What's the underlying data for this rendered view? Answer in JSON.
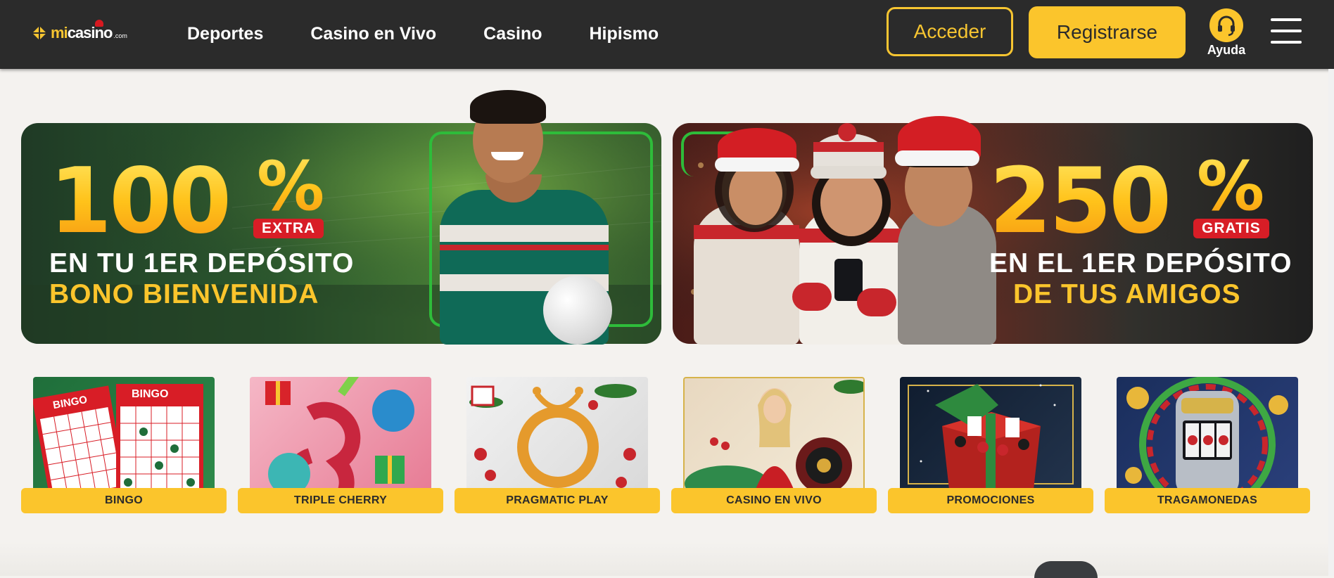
{
  "header": {
    "logo": {
      "text_mi": "mi",
      "text_casino": "casino",
      "text_dom": ".com",
      "icon": "micasino-logo-icon"
    },
    "nav": [
      {
        "label": "Deportes"
      },
      {
        "label": "Casino en Vivo"
      },
      {
        "label": "Casino"
      },
      {
        "label": "Hipismo"
      }
    ],
    "login_label": "Acceder",
    "register_label": "Registrarse",
    "help_label": "Ayuda",
    "help_icon": "headset-icon",
    "menu_icon": "hamburger-menu-icon"
  },
  "banners": {
    "left": {
      "number": "100",
      "percent": "%",
      "tag": "EXTRA",
      "line1": "EN TU 1ER DEPÓSITO",
      "line2": "BONO BIENVENIDA"
    },
    "right": {
      "number": "250",
      "percent": "%",
      "tag": "GRATIS",
      "line1": "EN EL 1ER DEPÓSITO",
      "line2": "DE TUS AMIGOS"
    }
  },
  "categories": [
    {
      "label": "BINGO"
    },
    {
      "label": "TRIPLE CHERRY"
    },
    {
      "label": "PRAGMATIC PLAY"
    },
    {
      "label": "CASINO EN VIVO"
    },
    {
      "label": "PROMOCIONES"
    },
    {
      "label": "TRAGAMONEDAS"
    }
  ],
  "bingo_card": {
    "title": "BINGO"
  },
  "colors": {
    "header_bg": "#2b2b2b",
    "accent": "#fbc52c",
    "tag_red": "#d81d26",
    "page_bg": "#f4f2ef"
  }
}
